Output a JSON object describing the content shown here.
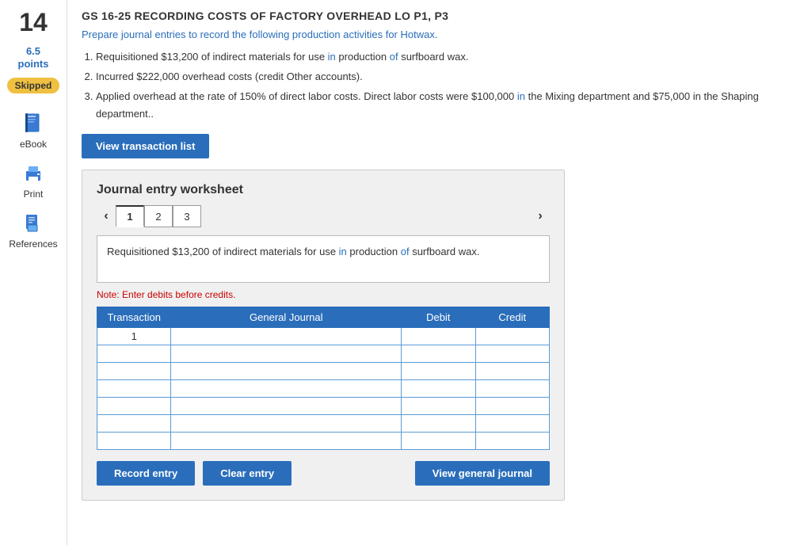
{
  "sidebar": {
    "question_number": "14",
    "points": "6.5",
    "points_label": "points",
    "skipped_label": "Skipped",
    "items": [
      {
        "id": "ebook",
        "label": "eBook",
        "icon": "book-icon"
      },
      {
        "id": "print",
        "label": "Print",
        "icon": "print-icon"
      },
      {
        "id": "references",
        "label": "References",
        "icon": "references-icon"
      }
    ]
  },
  "problem": {
    "title": "GS 16-25 Recording costs of factory overhead LO P1, P3",
    "description": "Prepare journal entries to record the following production activities for Hotwax.",
    "items": [
      "Requisitioned $13,200 of indirect materials for use in production of surfboard wax.",
      "Incurred $222,000 overhead costs (credit Other accounts).",
      "Applied overhead at the rate of 150% of direct labor costs. Direct labor costs were $100,000 in the Mixing department and $75,000 in the Shaping department.."
    ]
  },
  "view_transaction_btn": "View transaction list",
  "worksheet": {
    "title": "Journal entry worksheet",
    "tabs": [
      "1",
      "2",
      "3"
    ],
    "active_tab": "1",
    "description": "Requisitioned $13,200 of indirect materials for use in production of surfboard wax.",
    "note": "Note: Enter debits before credits.",
    "table": {
      "headers": [
        "Transaction",
        "General Journal",
        "Debit",
        "Credit"
      ],
      "rows": [
        {
          "transaction": "1",
          "journal": "",
          "debit": "",
          "credit": ""
        },
        {
          "transaction": "",
          "journal": "",
          "debit": "",
          "credit": ""
        },
        {
          "transaction": "",
          "journal": "",
          "debit": "",
          "credit": ""
        },
        {
          "transaction": "",
          "journal": "",
          "debit": "",
          "credit": ""
        },
        {
          "transaction": "",
          "journal": "",
          "debit": "",
          "credit": ""
        },
        {
          "transaction": "",
          "journal": "",
          "debit": "",
          "credit": ""
        },
        {
          "transaction": "",
          "journal": "",
          "debit": "",
          "credit": ""
        }
      ]
    },
    "buttons": {
      "record_entry": "Record entry",
      "clear_entry": "Clear entry",
      "view_general_journal": "View general journal"
    }
  }
}
